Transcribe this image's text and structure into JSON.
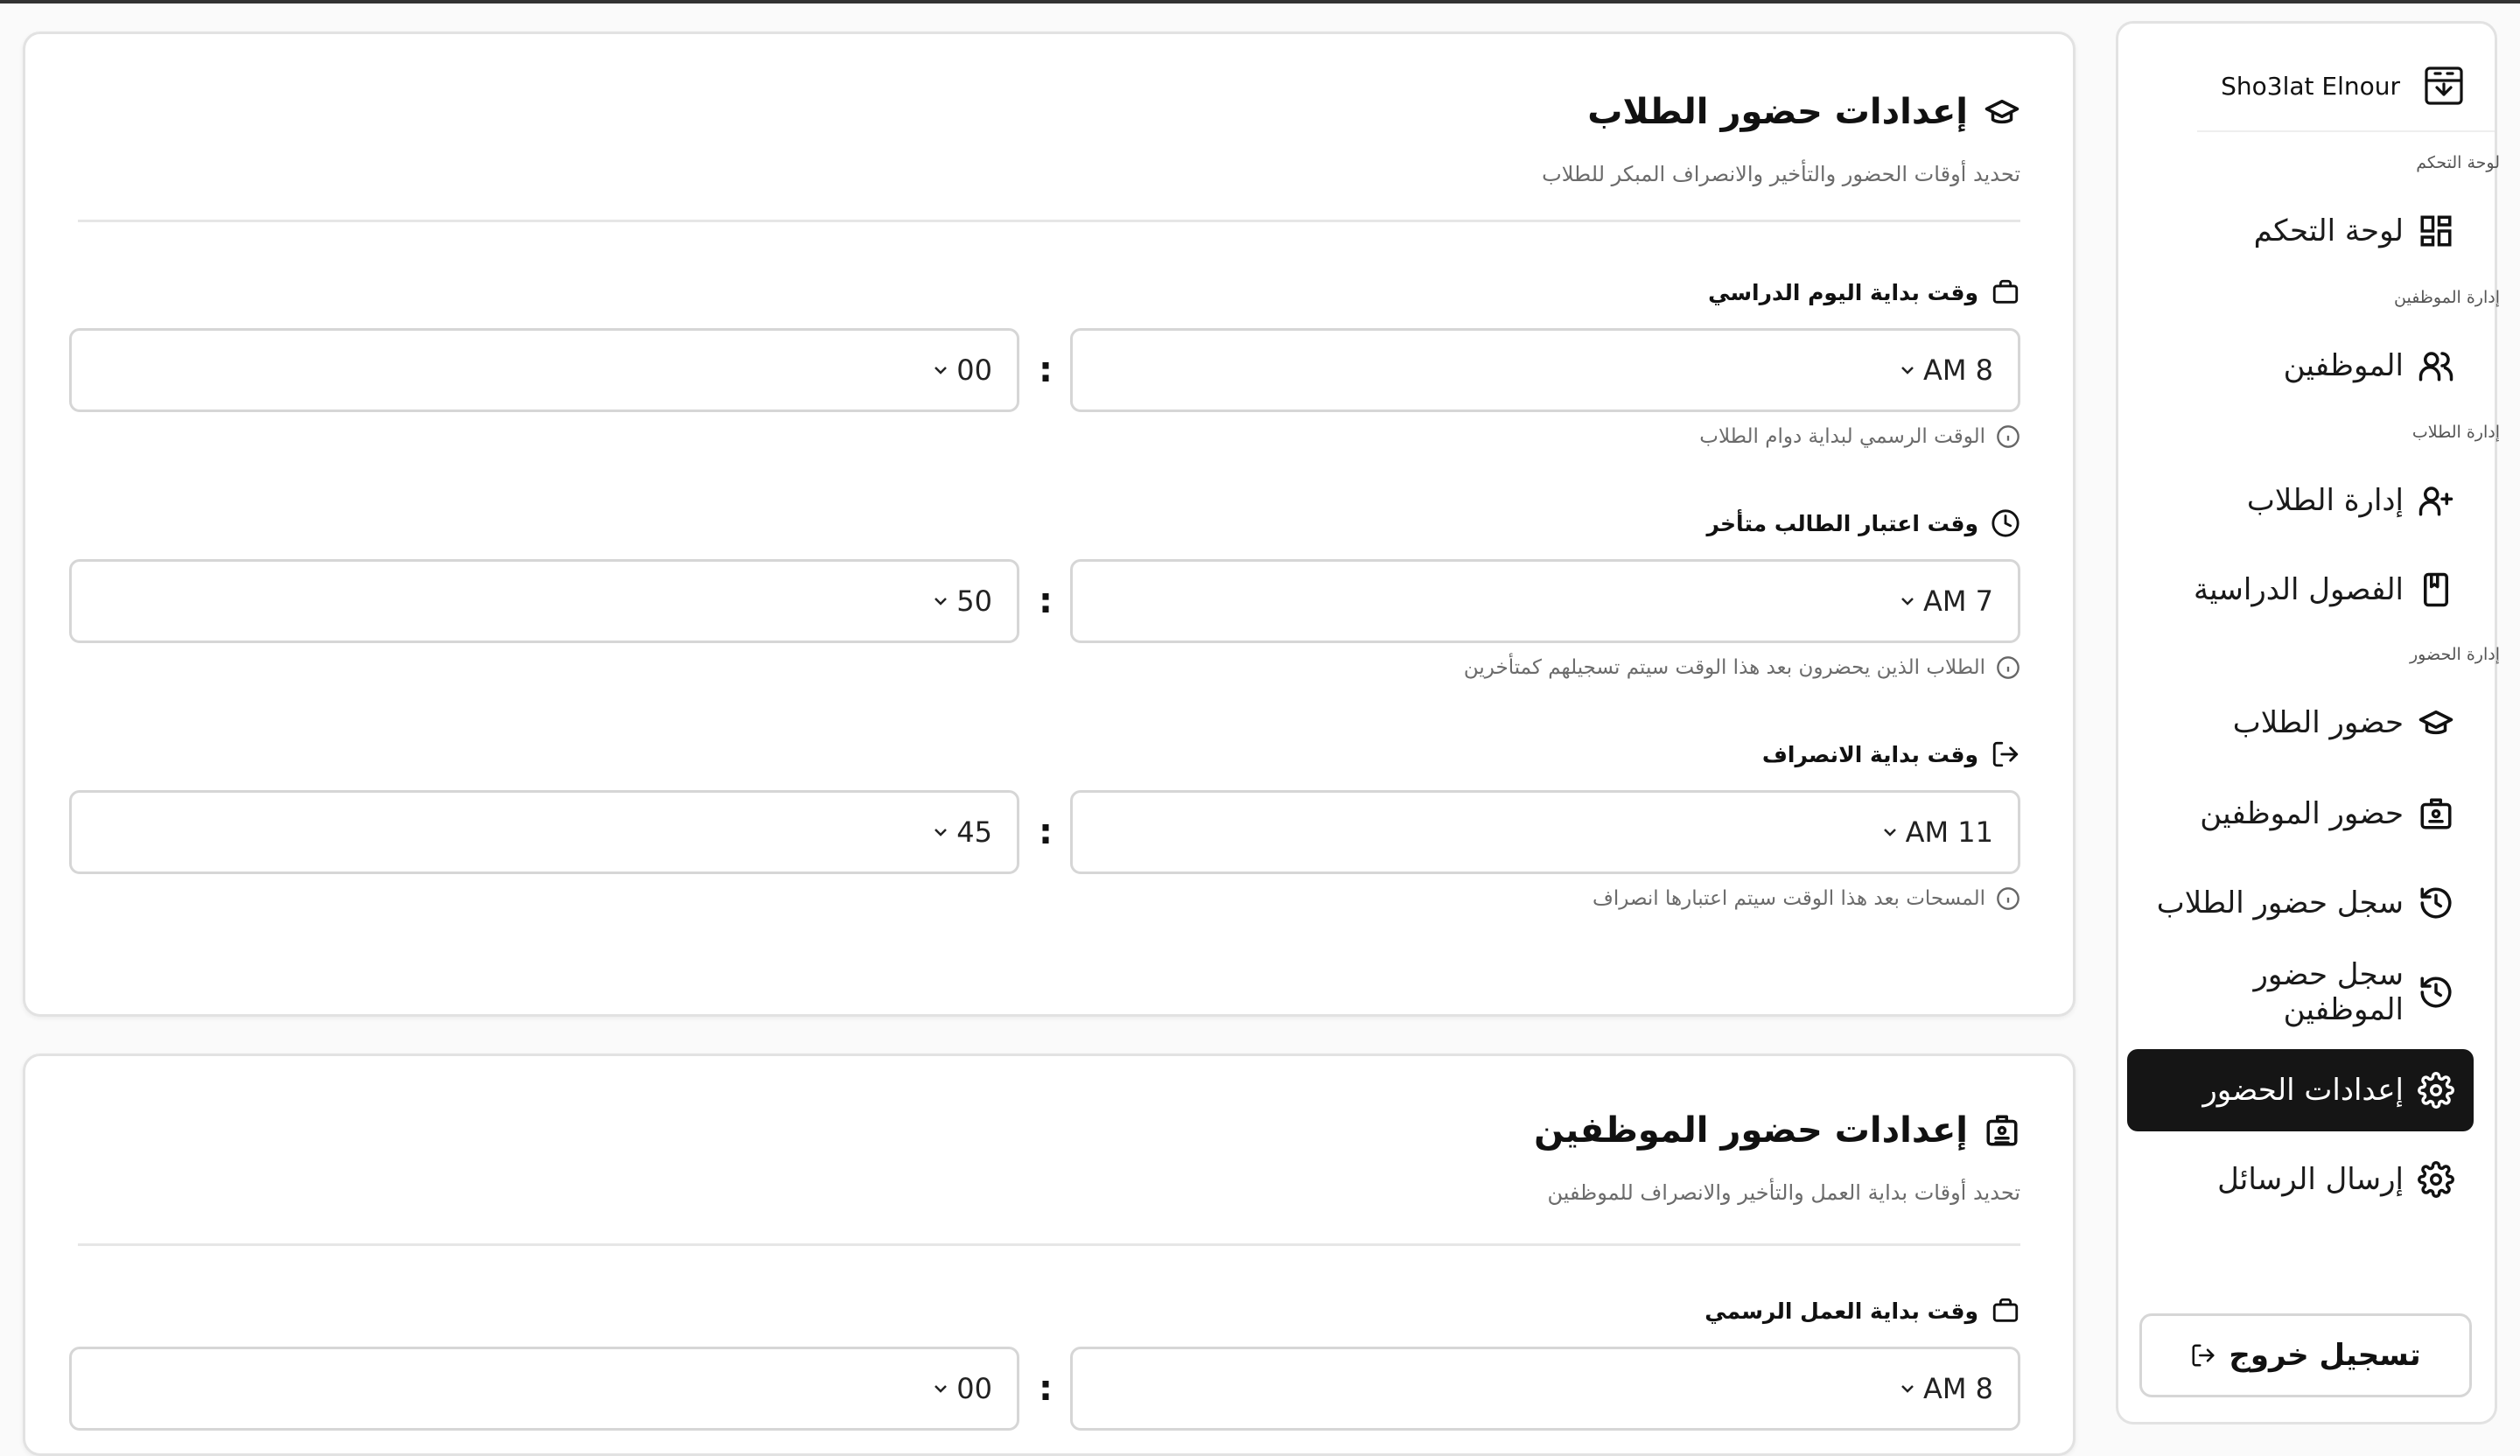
{
  "student_settings": {
    "title": "إعدادات حضور الطلاب",
    "subtitle": "تحديد أوقات الحضور والتأخير والانصراف المبكر للطلاب",
    "fields": [
      {
        "label": "وقت بداية اليوم الدراسي",
        "hour": "AM 8",
        "minute": "00",
        "hint": "الوقت الرسمي لبداية دوام الطلاب"
      },
      {
        "label": "وقت اعتبار الطالب متأخر",
        "hour": "AM 7",
        "minute": "50",
        "hint": "الطلاب الذين يحضرون بعد هذا الوقت سيتم تسجيلهم كمتأخرين"
      },
      {
        "label": "وقت بداية الانصراف",
        "hour": "AM 11",
        "minute": "45",
        "hint": "المسحات بعد هذا الوقت سيتم اعتبارها انصراف"
      }
    ]
  },
  "employee_settings": {
    "title": "إعدادات حضور الموظفين",
    "subtitle": "تحديد أوقات بداية العمل والتأخير والانصراف للموظفين",
    "fields": [
      {
        "label": "وقت بداية العمل الرسمي",
        "hour": "AM 8",
        "minute": "00"
      }
    ]
  },
  "colon": ":",
  "sidebar": {
    "brand": "Sho3lat Elnour",
    "groups": {
      "dashboard": "لوحة التحكم",
      "employees": "إدارة الموظفين",
      "students": "إدارة الطلاب",
      "attendance": "إدارة الحضور"
    },
    "items": [
      {
        "label": "لوحة التحكم",
        "icon": "dashboard-icon"
      },
      {
        "label": "الموظفين",
        "icon": "users-icon"
      },
      {
        "label": "إدارة الطلاب",
        "icon": "user-plus-icon"
      },
      {
        "label": "الفصول الدراسية",
        "icon": "book-icon"
      },
      {
        "label": "حضور الطلاب",
        "icon": "graduation-cap-icon"
      },
      {
        "label": "حضور الموظفين",
        "icon": "id-badge-icon"
      },
      {
        "label": "سجل حضور الطلاب",
        "icon": "history-icon"
      },
      {
        "label": "سجل حضور الموظفين",
        "icon": "history-icon"
      },
      {
        "label": "إعدادات الحضور",
        "icon": "gear-icon",
        "active": true
      },
      {
        "label": "إرسال الرسائل",
        "icon": "gear-icon"
      }
    ],
    "logout": "تسجيل خروج"
  },
  "colors": {
    "active_bg": "#151515",
    "muted_text": "#6b6b6b",
    "border": "#e2e2e2"
  }
}
